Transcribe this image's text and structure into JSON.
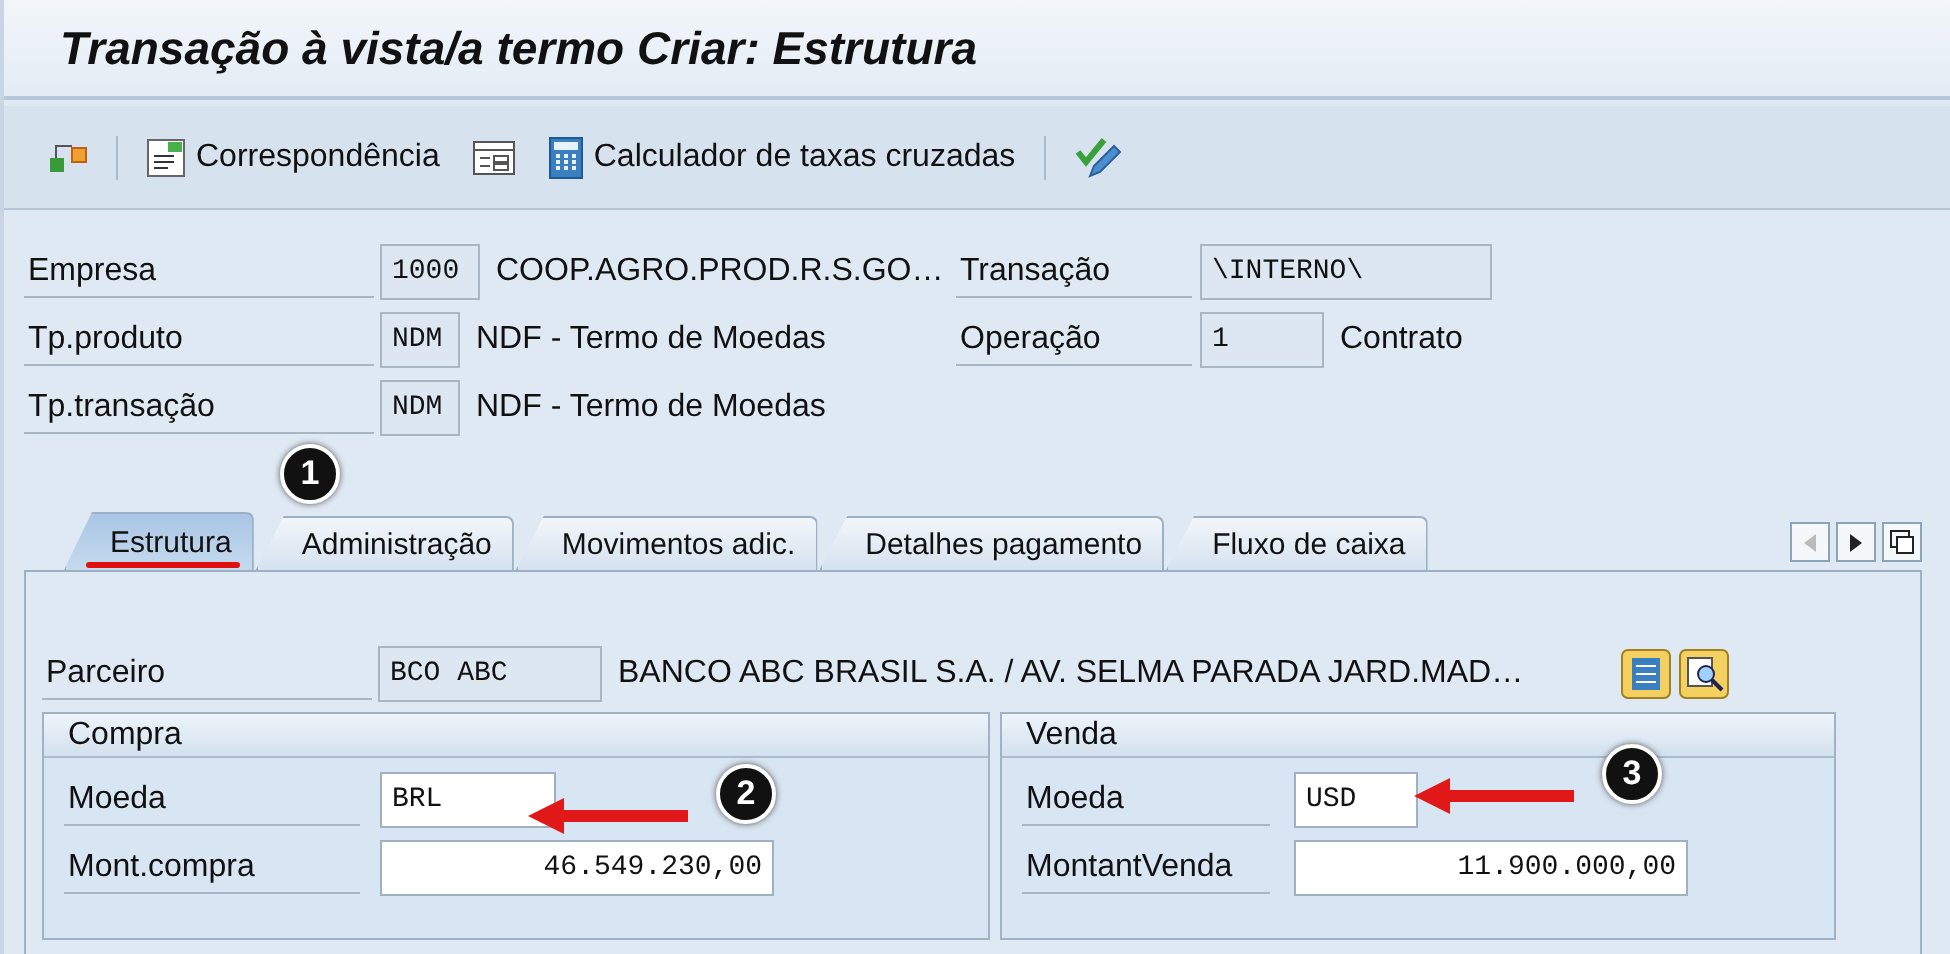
{
  "title": "Transação à vista/a termo Criar: Estrutura",
  "toolbar": [
    {
      "kind": "icon-button"
    },
    {
      "kind": "divider"
    },
    {
      "kind": "button",
      "label": "Correspondência"
    },
    {
      "kind": "icon-button"
    },
    {
      "kind": "button",
      "label": "Calculador de taxas cruzadas"
    },
    {
      "kind": "divider"
    },
    {
      "kind": "icon-button"
    }
  ],
  "header": {
    "left": [
      {
        "label": "Empresa",
        "value": "1000",
        "text": "COOP.AGRO.PROD.R.S.GO…"
      },
      {
        "label": "Tp.produto",
        "value": "NDM",
        "text": "NDF - Termo de Moedas"
      },
      {
        "label": "Tp.transação",
        "value": "NDM",
        "text": "NDF - Termo de Moedas"
      }
    ],
    "right": [
      {
        "label": "Transação",
        "value": "\\INTERNO\\"
      },
      {
        "label": "Operação",
        "value": "1",
        "text": "Contrato"
      }
    ]
  },
  "tabs": [
    {
      "label": "Estrutura",
      "selected": true,
      "underlined": true
    },
    {
      "label": "Administração",
      "selected": false,
      "underlined": false
    },
    {
      "label": "Movimentos adic.",
      "selected": false,
      "underlined": false
    },
    {
      "label": "Detalhes pagamento",
      "selected": false,
      "underlined": false
    },
    {
      "label": "Fluxo de caixa",
      "selected": false,
      "underlined": false
    }
  ],
  "partner": {
    "label": "Parceiro",
    "value": "BCO ABC",
    "text": "BANCO ABC BRASIL S.A. / AV. SELMA PARADA JARD.MAD…"
  },
  "groups": [
    {
      "title": "Compra",
      "fields": [
        {
          "label": "Moeda",
          "value": "BRL",
          "kind": "short"
        },
        {
          "label": "Mont.compra",
          "value": "46.549.230,00",
          "kind": "amount"
        }
      ]
    },
    {
      "title": "Venda",
      "fields": [
        {
          "label": "Moeda",
          "value": "USD",
          "kind": "short"
        },
        {
          "label": "MontantVenda",
          "value": "11.900.000,00",
          "kind": "amount"
        }
      ]
    }
  ],
  "annotations": [
    {
      "label": "1",
      "kind": "marker"
    },
    {
      "label": "2",
      "kind": "arrow-marker"
    },
    {
      "label": "3",
      "kind": "arrow-marker"
    }
  ]
}
